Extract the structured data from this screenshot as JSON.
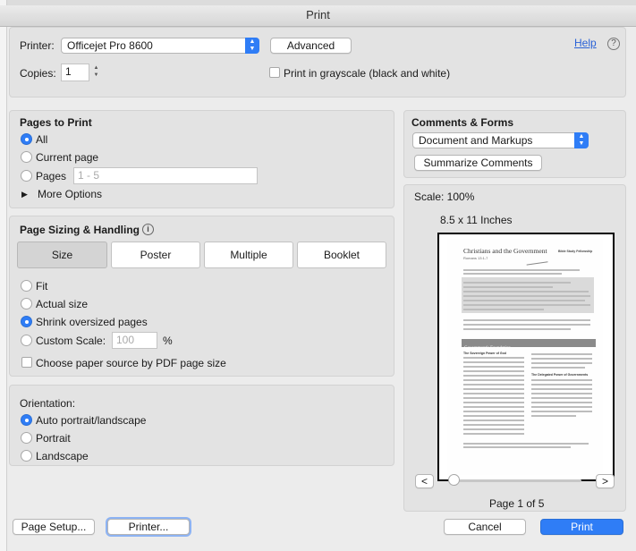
{
  "window": {
    "title": "Print"
  },
  "printer": {
    "label": "Printer:",
    "value": "Officejet Pro 8600",
    "advanced_label": "Advanced",
    "help_label": "Help",
    "copies_label": "Copies:",
    "copies_value": "1",
    "grayscale_label": "Print in grayscale (black and white)",
    "grayscale_checked": false
  },
  "pages_to_print": {
    "heading": "Pages to Print",
    "options": [
      {
        "label": "All",
        "selected": true
      },
      {
        "label": "Current page",
        "selected": false
      },
      {
        "label": "Pages",
        "selected": false
      }
    ],
    "pages_placeholder": "1 - 5",
    "more_options_label": "More Options"
  },
  "page_sizing": {
    "heading": "Page Sizing & Handling",
    "tabs": [
      {
        "label": "Size",
        "selected": true
      },
      {
        "label": "Poster",
        "selected": false
      },
      {
        "label": "Multiple",
        "selected": false
      },
      {
        "label": "Booklet",
        "selected": false
      }
    ],
    "options": [
      {
        "label": "Fit",
        "selected": false
      },
      {
        "label": "Actual size",
        "selected": false
      },
      {
        "label": "Shrink oversized pages",
        "selected": true
      },
      {
        "label": "Custom Scale:",
        "selected": false
      }
    ],
    "custom_scale_placeholder": "100",
    "percent_sign": "%",
    "paper_source_label": "Choose paper source by PDF page size",
    "paper_source_checked": false
  },
  "orientation": {
    "heading": "Orientation:",
    "options": [
      {
        "label": "Auto portrait/landscape",
        "selected": true
      },
      {
        "label": "Portrait",
        "selected": false
      },
      {
        "label": "Landscape",
        "selected": false
      }
    ]
  },
  "comments_forms": {
    "heading": "Comments & Forms",
    "value": "Document and Markups",
    "summarize_label": "Summarize Comments"
  },
  "preview": {
    "scale_text": "Scale: 100%",
    "paper_size": "8.5 x 11 Inches",
    "prev_label": "<",
    "next_label": ">",
    "page_indicator": "Page 1 of 5",
    "slider_position": 0,
    "doc": {
      "title": "Christians and the Government",
      "subtitle": "Romans 13:1-7",
      "brand": "Bible Study Fellowship",
      "section_bar": "Government's Foundation",
      "col_heading_left": "The Sovereign Power of God",
      "col_heading_right": "The Delegated Power of Governments"
    }
  },
  "footer": {
    "page_setup_label": "Page Setup...",
    "printer_label": "Printer...",
    "cancel_label": "Cancel",
    "print_label": "Print"
  },
  "colors": {
    "accent": "#2f7df6",
    "window_bg": "#ececec",
    "panel_bg": "#e3e3e3",
    "link": "#2a62d6"
  }
}
